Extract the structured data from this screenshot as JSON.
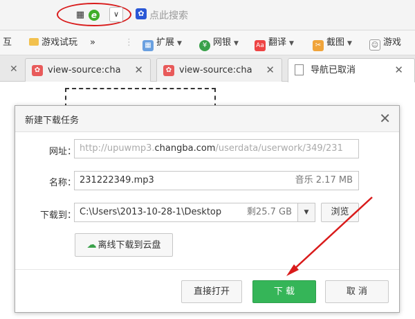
{
  "address_bar": {
    "search_placeholder": "点此搜索"
  },
  "bookmarks": [
    {
      "label": "互"
    },
    {
      "label": "游戏试玩"
    },
    {
      "label": "»"
    },
    {
      "label": "扩展"
    },
    {
      "label": "网银"
    },
    {
      "label": "翻译"
    },
    {
      "label": "截图"
    },
    {
      "label": "游戏"
    }
  ],
  "tabs": [
    {
      "title": "view-source:cha"
    },
    {
      "title": "view-source:cha"
    },
    {
      "title": "导航已取消"
    }
  ],
  "dialog": {
    "title": "新建下载任务",
    "url_label": "网址：",
    "url_prefix": "http://upuwmp3.",
    "url_domain": "changba.com",
    "url_suffix": "/userdata/userwork/349/231",
    "name_label": "名称：",
    "name_value": "231222349.mp3",
    "name_info": "音乐 2.17 MB",
    "dest_label": "下载到：",
    "dest_value": "C:\\Users\\2013-10-28-1\\Desktop",
    "dest_free": "剩25.7 GB",
    "browse_label": "浏览",
    "cloud_label": "离线下载到云盘",
    "open_label": "直接打开",
    "download_label": "下 载",
    "cancel_label": "取 消"
  },
  "colors": {
    "primary_green": "#35b558",
    "annotation_red": "#d91b1b"
  }
}
